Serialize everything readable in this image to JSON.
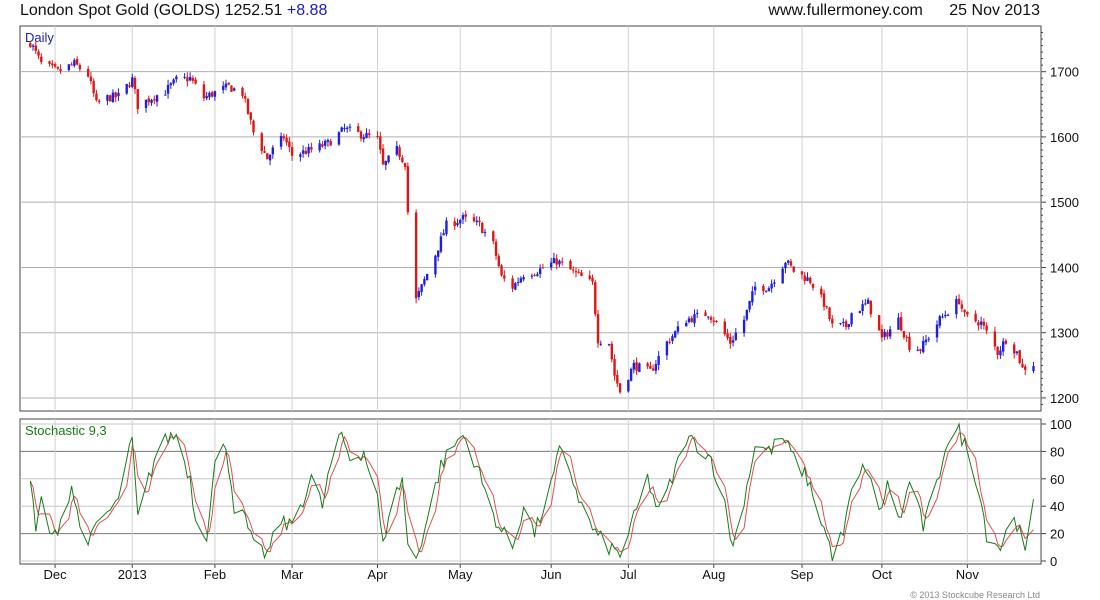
{
  "header": {
    "title": "London Spot Gold (GOLDS)",
    "price": "1252.51",
    "change": "+8.88",
    "site": "www.fullermoney.com",
    "date": "25 Nov 2013"
  },
  "colors": {
    "up": "#1f1fe0",
    "down": "#e01515",
    "stoch_k": "#1a7a1a",
    "stoch_d": "#e05050",
    "grid": "#b0b0b0"
  },
  "copyright": "© 2013 Stockcube Research Ltd",
  "chart_data": [
    {
      "type": "candlestick",
      "title": "Daily",
      "x_tick_labels": [
        "Dec",
        "2013",
        "Feb",
        "Mar",
        "Apr",
        "May",
        "Jun",
        "Jul",
        "Aug",
        "Sep",
        "Oct",
        "Nov"
      ],
      "y_tick_labels": [
        "1700",
        "1600",
        "1500",
        "1400",
        "1300",
        "1200"
      ],
      "ylim": [
        1180,
        1770
      ],
      "grid": true,
      "y_axis": "right",
      "close_path": [
        [
          "2012-11-26",
          1745
        ],
        [
          "2012-11-30",
          1712
        ],
        [
          "2012-12-06",
          1700
        ],
        [
          "2012-12-12",
          1712
        ],
        [
          "2012-12-17",
          1695
        ],
        [
          "2012-12-20",
          1650
        ],
        [
          "2012-12-24",
          1660
        ],
        [
          "2012-12-28",
          1662
        ],
        [
          "2013-01-02",
          1688
        ],
        [
          "2013-01-04",
          1648
        ],
        [
          "2013-01-09",
          1660
        ],
        [
          "2013-01-14",
          1670
        ],
        [
          "2013-01-18",
          1687
        ],
        [
          "2013-01-23",
          1690
        ],
        [
          "2013-01-28",
          1660
        ],
        [
          "2013-02-01",
          1668
        ],
        [
          "2013-02-06",
          1677
        ],
        [
          "2013-02-11",
          1667
        ],
        [
          "2013-02-15",
          1607
        ],
        [
          "2013-02-20",
          1567
        ],
        [
          "2013-02-22",
          1580
        ],
        [
          "2013-02-26",
          1600
        ],
        [
          "2013-03-01",
          1572
        ],
        [
          "2013-03-08",
          1580
        ],
        [
          "2013-03-14",
          1590
        ],
        [
          "2013-03-20",
          1612
        ],
        [
          "2013-03-25",
          1605
        ],
        [
          "2013-04-01",
          1597
        ],
        [
          "2013-04-03",
          1555
        ],
        [
          "2013-04-08",
          1580
        ],
        [
          "2013-04-11",
          1560
        ],
        [
          "2013-04-12",
          1485
        ],
        [
          "2013-04-15",
          1350
        ],
        [
          "2013-04-17",
          1370
        ],
        [
          "2013-04-22",
          1420
        ],
        [
          "2013-04-26",
          1465
        ],
        [
          "2013-05-02",
          1475
        ],
        [
          "2013-05-08",
          1465
        ],
        [
          "2013-05-13",
          1435
        ],
        [
          "2013-05-16",
          1385
        ],
        [
          "2013-05-20",
          1370
        ],
        [
          "2013-05-24",
          1390
        ],
        [
          "2013-05-29",
          1395
        ],
        [
          "2013-06-05",
          1410
        ],
        [
          "2013-06-12",
          1390
        ],
        [
          "2013-06-18",
          1375
        ],
        [
          "2013-06-20",
          1290
        ],
        [
          "2013-06-24",
          1285
        ],
        [
          "2013-06-26",
          1235
        ],
        [
          "2013-06-28",
          1210
        ],
        [
          "2013-07-03",
          1250
        ],
        [
          "2013-07-09",
          1240
        ],
        [
          "2013-07-15",
          1285
        ],
        [
          "2013-07-22",
          1320
        ],
        [
          "2013-07-30",
          1330
        ],
        [
          "2013-08-02",
          1315
        ],
        [
          "2013-08-07",
          1285
        ],
        [
          "2013-08-12",
          1320
        ],
        [
          "2013-08-16",
          1370
        ],
        [
          "2013-08-21",
          1370
        ],
        [
          "2013-08-27",
          1410
        ],
        [
          "2013-08-30",
          1395
        ],
        [
          "2013-09-05",
          1380
        ],
        [
          "2013-09-10",
          1345
        ],
        [
          "2013-09-13",
          1310
        ],
        [
          "2013-09-18",
          1310
        ],
        [
          "2013-09-20",
          1330
        ],
        [
          "2013-09-26",
          1345
        ],
        [
          "2013-10-01",
          1290
        ],
        [
          "2013-10-07",
          1320
        ],
        [
          "2013-10-11",
          1280
        ],
        [
          "2013-10-15",
          1275
        ],
        [
          "2013-10-22",
          1320
        ],
        [
          "2013-10-29",
          1350
        ],
        [
          "2013-10-31",
          1325
        ],
        [
          "2013-11-06",
          1315
        ],
        [
          "2013-11-12",
          1270
        ],
        [
          "2013-11-15",
          1290
        ],
        [
          "2013-11-19",
          1270
        ],
        [
          "2013-11-21",
          1245
        ],
        [
          "2013-11-25",
          1252
        ]
      ]
    },
    {
      "type": "line",
      "title": "Stochastic 9,3",
      "x_tick_labels": [
        "Dec",
        "2013",
        "Feb",
        "Mar",
        "Apr",
        "May",
        "Jun",
        "Jul",
        "Aug",
        "Sep",
        "Oct",
        "Nov"
      ],
      "y_tick_labels": [
        "100",
        "80",
        "60",
        "40",
        "20",
        "0"
      ],
      "ylim": [
        0,
        100
      ],
      "grid": true,
      "reference_lines": [
        80,
        20
      ],
      "y_axis": "right",
      "k_path": [
        [
          "2012-11-26",
          60
        ],
        [
          "2012-11-28",
          20
        ],
        [
          "2012-11-30",
          45
        ],
        [
          "2012-12-04",
          15
        ],
        [
          "2012-12-07",
          30
        ],
        [
          "2012-12-11",
          55
        ],
        [
          "2012-12-14",
          25
        ],
        [
          "2012-12-18",
          15
        ],
        [
          "2012-12-21",
          30
        ],
        [
          "2012-12-27",
          40
        ],
        [
          "2013-01-02",
          88
        ],
        [
          "2013-01-04",
          30
        ],
        [
          "2013-01-08",
          60
        ],
        [
          "2013-01-11",
          80
        ],
        [
          "2013-01-15",
          90
        ],
        [
          "2013-01-18",
          92
        ],
        [
          "2013-01-23",
          60
        ],
        [
          "2013-01-25",
          30
        ],
        [
          "2013-01-29",
          20
        ],
        [
          "2013-02-01",
          70
        ],
        [
          "2013-02-05",
          85
        ],
        [
          "2013-02-08",
          40
        ],
        [
          "2013-02-12",
          30
        ],
        [
          "2013-02-15",
          10
        ],
        [
          "2013-02-20",
          5
        ],
        [
          "2013-02-25",
          30
        ],
        [
          "2013-02-28",
          25
        ],
        [
          "2013-03-05",
          45
        ],
        [
          "2013-03-08",
          60
        ],
        [
          "2013-03-12",
          40
        ],
        [
          "2013-03-15",
          70
        ],
        [
          "2013-03-19",
          92
        ],
        [
          "2013-03-22",
          75
        ],
        [
          "2013-03-27",
          80
        ],
        [
          "2013-04-01",
          45
        ],
        [
          "2013-04-03",
          10
        ],
        [
          "2013-04-05",
          35
        ],
        [
          "2013-04-10",
          60
        ],
        [
          "2013-04-12",
          10
        ],
        [
          "2013-04-15",
          2
        ],
        [
          "2013-04-19",
          30
        ],
        [
          "2013-04-24",
          70
        ],
        [
          "2013-04-29",
          85
        ],
        [
          "2013-05-02",
          92
        ],
        [
          "2013-05-07",
          70
        ],
        [
          "2013-05-10",
          50
        ],
        [
          "2013-05-15",
          25
        ],
        [
          "2013-05-20",
          10
        ],
        [
          "2013-05-24",
          40
        ],
        [
          "2013-05-28",
          20
        ],
        [
          "2013-06-03",
          55
        ],
        [
          "2013-06-06",
          80
        ],
        [
          "2013-06-10",
          65
        ],
        [
          "2013-06-14",
          40
        ],
        [
          "2013-06-19",
          20
        ],
        [
          "2013-06-24",
          10
        ],
        [
          "2013-06-28",
          5
        ],
        [
          "2013-07-02",
          25
        ],
        [
          "2013-07-08",
          60
        ],
        [
          "2013-07-12",
          35
        ],
        [
          "2013-07-17",
          60
        ],
        [
          "2013-07-22",
          90
        ],
        [
          "2013-07-26",
          85
        ],
        [
          "2013-07-31",
          75
        ],
        [
          "2013-08-05",
          40
        ],
        [
          "2013-08-08",
          10
        ],
        [
          "2013-08-13",
          55
        ],
        [
          "2013-08-16",
          85
        ],
        [
          "2013-08-21",
          80
        ],
        [
          "2013-08-26",
          90
        ],
        [
          "2013-08-30",
          75
        ],
        [
          "2013-09-04",
          60
        ],
        [
          "2013-09-09",
          30
        ],
        [
          "2013-09-13",
          5
        ],
        [
          "2013-09-17",
          20
        ],
        [
          "2013-09-20",
          50
        ],
        [
          "2013-09-25",
          70
        ],
        [
          "2013-09-30",
          35
        ],
        [
          "2013-10-03",
          55
        ],
        [
          "2013-10-08",
          30
        ],
        [
          "2013-10-11",
          60
        ],
        [
          "2013-10-16",
          25
        ],
        [
          "2013-10-21",
          55
        ],
        [
          "2013-10-24",
          85
        ],
        [
          "2013-10-29",
          95
        ],
        [
          "2013-11-01",
          80
        ],
        [
          "2013-11-05",
          55
        ],
        [
          "2013-11-08",
          20
        ],
        [
          "2013-11-13",
          10
        ],
        [
          "2013-11-18",
          35
        ],
        [
          "2013-11-20",
          20
        ],
        [
          "2013-11-22",
          5
        ],
        [
          "2013-11-25",
          40
        ]
      ]
    }
  ]
}
